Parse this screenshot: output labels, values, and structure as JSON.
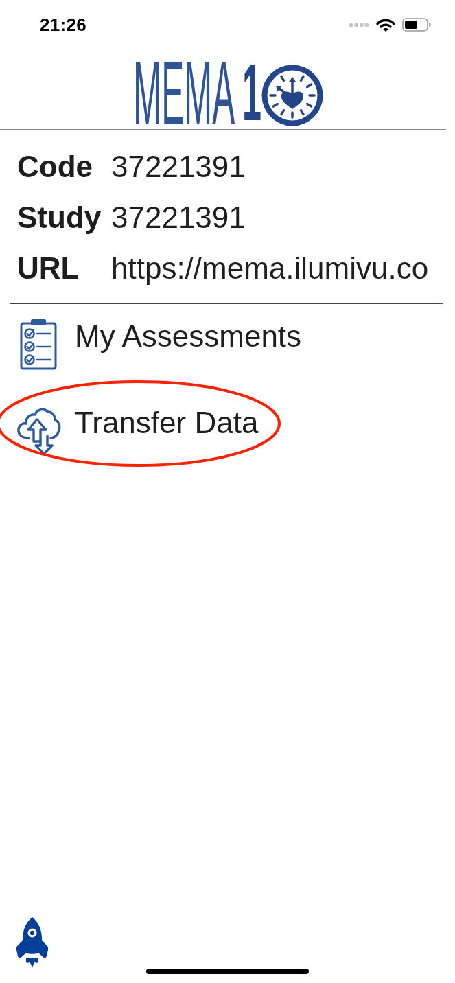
{
  "status_bar": {
    "time": "21:26"
  },
  "logo": {
    "wordmark": "MEMA",
    "digit": "1"
  },
  "fields": [
    {
      "label": "Code",
      "value": "37221391"
    },
    {
      "label": "Study",
      "value": "37221391"
    },
    {
      "label": "URL",
      "value": "https://mema.ilumivu.co"
    }
  ],
  "menu": [
    {
      "kind": "assessments",
      "label": "My Assessments",
      "highlighted": false
    },
    {
      "kind": "transfer",
      "label": "Transfer Data",
      "highlighted": true
    }
  ]
}
